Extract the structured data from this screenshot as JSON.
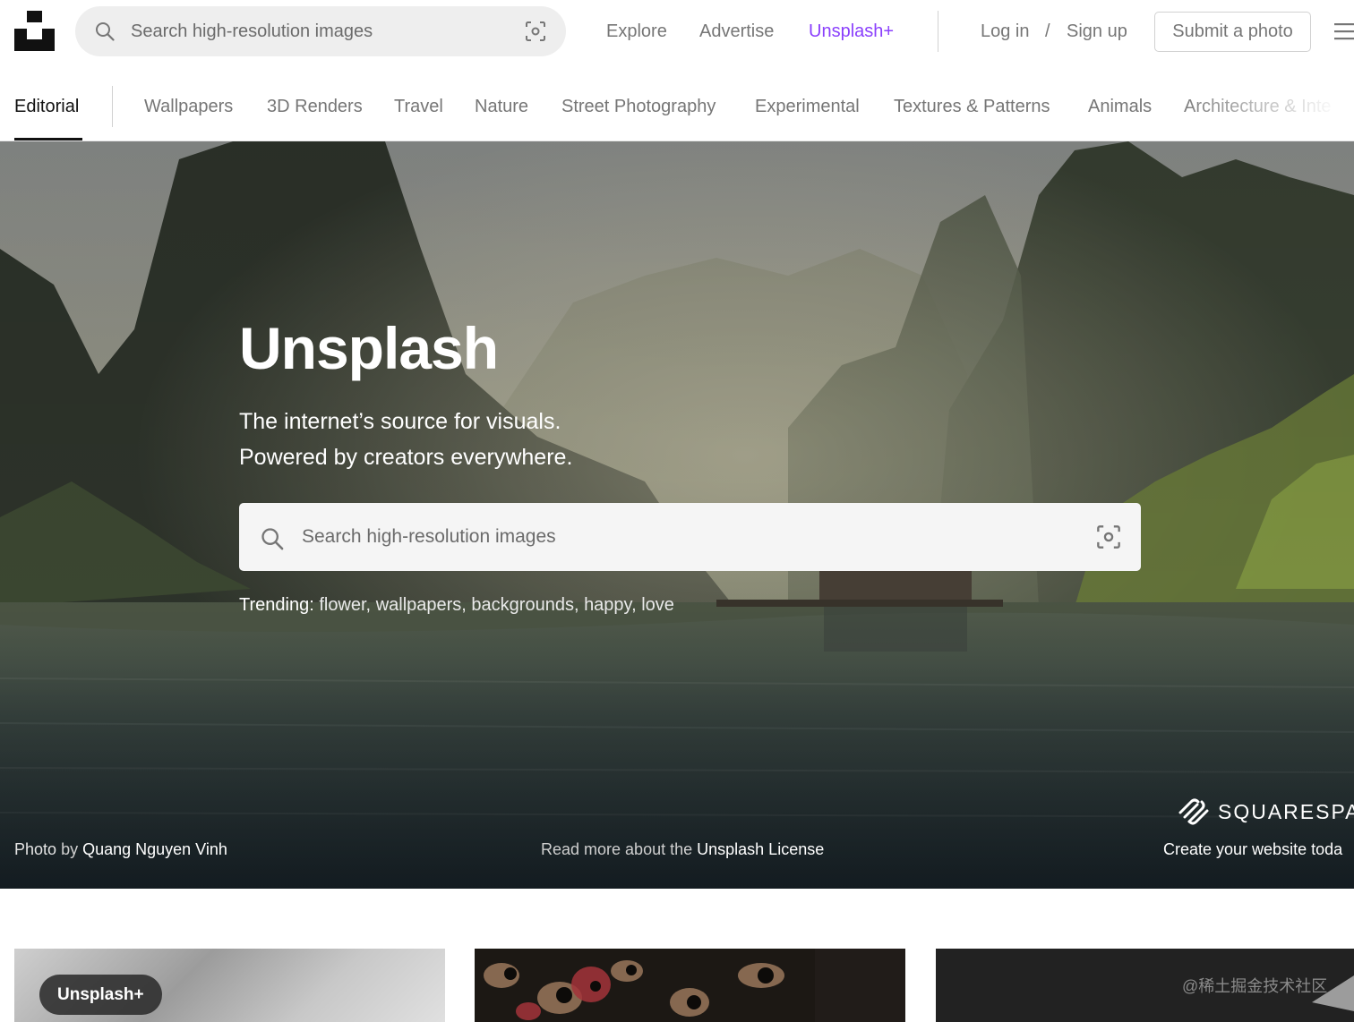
{
  "header": {
    "search_placeholder": "Search high-resolution images",
    "nav": {
      "explore": "Explore",
      "advertise": "Advertise",
      "plus": "Unsplash+",
      "login": "Log in",
      "slash": "/",
      "signup": "Sign up"
    },
    "submit_label": "Submit a photo",
    "accent_color": "#8a3ffc"
  },
  "tabs": {
    "active": "Editorial",
    "items": [
      "Wallpapers",
      "3D Renders",
      "Travel",
      "Nature",
      "Street Photography",
      "Experimental",
      "Textures & Patterns",
      "Animals",
      "Architecture & Inte"
    ]
  },
  "hero": {
    "title": "Unsplash",
    "subtitle_line1": "The internet’s source for visuals.",
    "subtitle_line2": "Powered by creators everywhere.",
    "search_placeholder": "Search high-resolution images",
    "trending_label": "Trending:",
    "trending": [
      "flower,",
      "wallpapers,",
      "backgrounds,",
      "happy,",
      "love"
    ],
    "credit_prefix": "Photo",
    "credit_by": "by",
    "credit_name": "Quang Nguyen Vinh",
    "license_prefix": "Read more about the",
    "license_link": "Unsplash License",
    "sponsor_name": "SQUARESPAC",
    "sponsor_tagline": "Create your website toda"
  },
  "grid": {
    "badge": "Unsplash+",
    "watermark": "@稀土掘金技术社区"
  }
}
